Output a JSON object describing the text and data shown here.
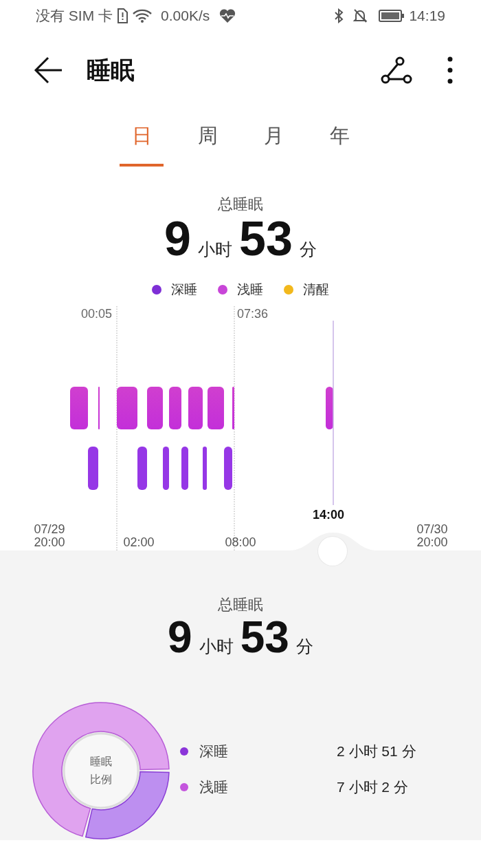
{
  "status_bar": {
    "carrier": "没有 SIM 卡",
    "speed": "0.00K/s",
    "time": "14:19"
  },
  "header": {
    "title": "睡眠"
  },
  "tabs": [
    {
      "label": "日",
      "selected": true
    },
    {
      "label": "周",
      "selected": false
    },
    {
      "label": "月",
      "selected": false
    },
    {
      "label": "年",
      "selected": false
    }
  ],
  "summary": {
    "label": "总睡眠",
    "hours": "9",
    "hours_unit": "小时",
    "minutes": "53",
    "minutes_unit": "分"
  },
  "legend": [
    {
      "label": "深睡",
      "color": "#7e2fd6"
    },
    {
      "label": "浅睡",
      "color": "#c845d8"
    },
    {
      "label": "清醒",
      "color": "#f2b81c"
    }
  ],
  "timeline": {
    "start_marker": "00:05",
    "end_marker": "07:36",
    "cursor_time": "14:00",
    "axis_labels": [
      {
        "date": "07/29",
        "time": "20:00"
      },
      {
        "time": "02:00"
      },
      {
        "time": "08:00"
      },
      {
        "date": "07/30",
        "time": "20:00"
      }
    ]
  },
  "details": {
    "summary": {
      "label": "总睡眠",
      "hours": "9",
      "hours_unit": "小时",
      "minutes": "53",
      "minutes_unit": "分"
    },
    "ratio_chart": {
      "center_label": "睡眠比例",
      "chart_data": {
        "type": "donut",
        "values": [
          29,
          71
        ]
      }
    },
    "breakdown": [
      {
        "label": "深睡",
        "value": "2 小时 51 分",
        "color": "#8b35d9"
      },
      {
        "label": "浅睡",
        "value": "7 小时 2 分",
        "color": "#c455dd"
      }
    ]
  }
}
